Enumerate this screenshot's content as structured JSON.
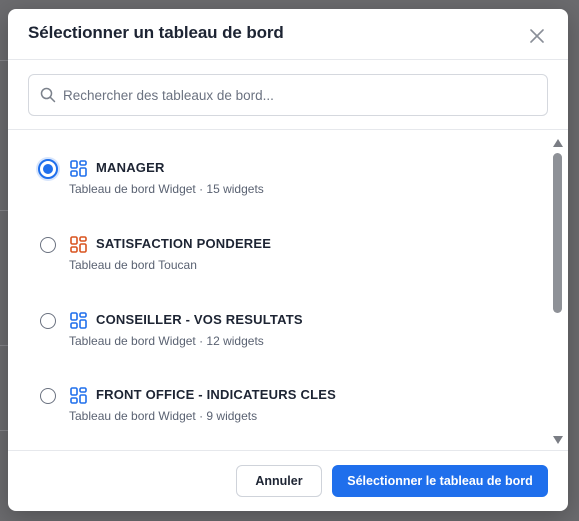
{
  "colors": {
    "accent": "#1f6fec",
    "icon_blue": "#1f6fec",
    "icon_orange": "#d9531e",
    "text_primary": "#1d2433",
    "text_secondary": "#5a6272"
  },
  "modal": {
    "title": "Sélectionner un tableau de bord",
    "close_icon": "close-icon"
  },
  "search": {
    "placeholder": "Rechercher des tableaux de bord...",
    "value": "",
    "icon": "search-icon"
  },
  "dashboards": [
    {
      "name": "MANAGER",
      "description": "Tableau de bord Widget · 15 widgets",
      "icon": "widget-grid-icon",
      "icon_color": "#1f6fec",
      "selected": true
    },
    {
      "name": "SATISFACTION PONDEREE",
      "description": "Tableau de bord Toucan",
      "icon": "toucan-grid-icon",
      "icon_color": "#d9531e",
      "selected": false
    },
    {
      "name": "CONSEILLER - VOS RESULTATS",
      "description": "Tableau de bord Widget · 12 widgets",
      "icon": "widget-grid-icon",
      "icon_color": "#1f6fec",
      "selected": false
    },
    {
      "name": "FRONT OFFICE - INDICATEURS CLES",
      "description": "Tableau de bord Widget · 9 widgets",
      "icon": "widget-grid-icon",
      "icon_color": "#1f6fec",
      "selected": false
    }
  ],
  "footer": {
    "cancel_label": "Annuler",
    "confirm_label": "Sélectionner le tableau de bord"
  }
}
